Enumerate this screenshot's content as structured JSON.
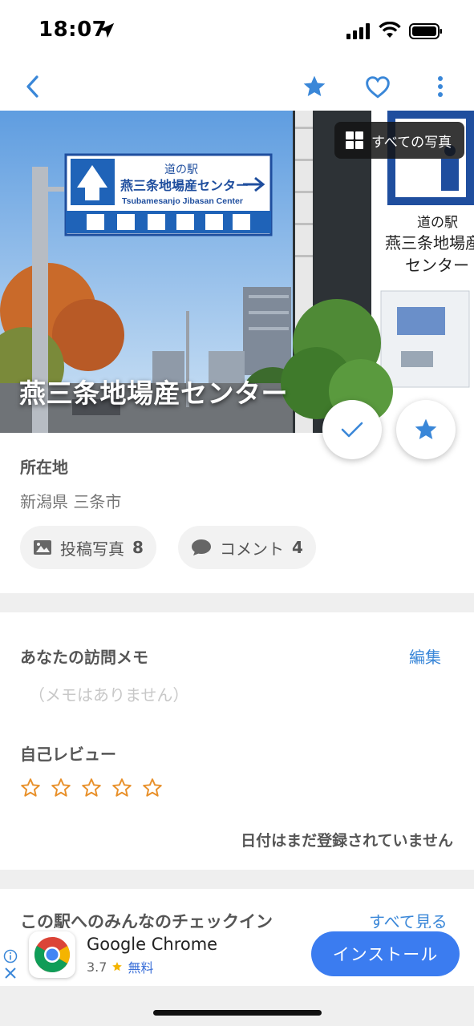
{
  "status_bar": {
    "time": "18:07"
  },
  "nav": {
    "back_icon": "chevron-left-icon",
    "star_icon": "star-icon",
    "heart_icon": "heart-icon",
    "more_icon": "more-vertical-icon",
    "accent": "#3a87d8"
  },
  "hero": {
    "all_photos_label": "すべての写真",
    "title": "燕三条地場産センター",
    "sign": {
      "line1": "道の駅",
      "line2": "燕三条地場産センター",
      "line3": "Tsubamesanjo Jibasan Center"
    },
    "poster": {
      "line1": "道の駅",
      "line2": "燕三条地場産",
      "line3": "センター"
    }
  },
  "location": {
    "label": "所在地",
    "value": "新潟県 三条市"
  },
  "chips": [
    {
      "label": "投稿写真",
      "count": "8"
    },
    {
      "label": "コメント",
      "count": "4"
    }
  ],
  "memo": {
    "title": "あなたの訪問メモ",
    "edit_label": "編集",
    "empty_text": "（メモはありません）"
  },
  "review": {
    "title": "自己レビュー",
    "stars": 0,
    "max_stars": 5,
    "star_color": "#e8902a"
  },
  "date_note": "日付はまだ登録されていません",
  "checkin": {
    "title": "この駅へのみんなのチェックイン",
    "see_all": "すべて見る"
  },
  "ad": {
    "app_name": "Google Chrome",
    "rating": "3.7",
    "price": "無料",
    "install_label": "インストール"
  }
}
